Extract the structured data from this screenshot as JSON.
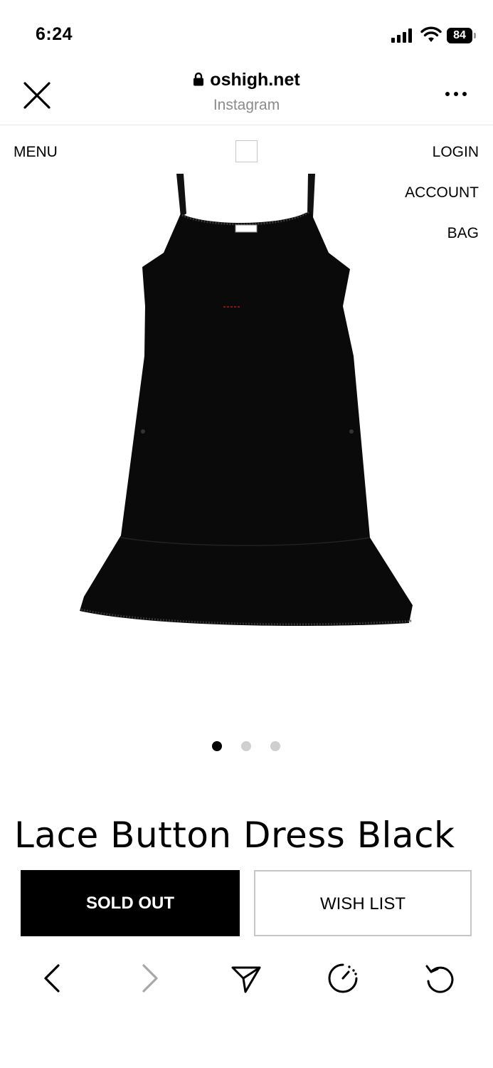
{
  "status_bar": {
    "time": "6:24",
    "battery": "84"
  },
  "browser": {
    "domain": "oshigh.net",
    "subtitle": "Instagram"
  },
  "nav": {
    "menu": "MENU",
    "login": "LOGIN",
    "account": "ACCOUNT",
    "bag": "BAG"
  },
  "carousel": {
    "current_page": 1,
    "total_pages": 3
  },
  "product": {
    "title": "Lace Button Dress Black",
    "sold_out": "SOLD OUT",
    "wish_list": "WISH LIST"
  },
  "icons": {
    "close": "close-icon",
    "lock": "lock-icon",
    "more": "more-icon",
    "back": "chevron-left-icon",
    "forward": "chevron-right-icon",
    "share": "send-icon",
    "speed": "gauge-icon",
    "reload": "reload-icon"
  }
}
